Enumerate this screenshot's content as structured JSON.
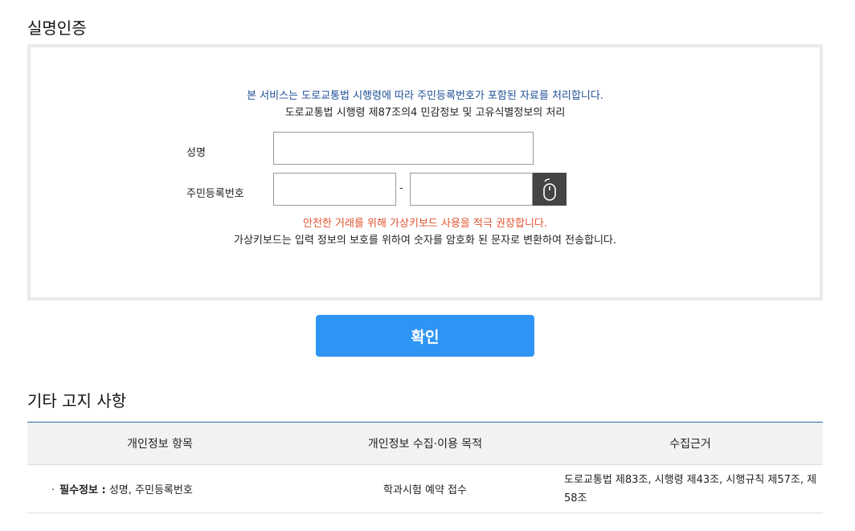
{
  "section1": {
    "title": "실명인증"
  },
  "auth": {
    "notice_blue": "본 서비스는 도로교통법 시행령에 따라 주민등록번호가 포함된 자료를 처리합니다.",
    "notice_black": "도로교통법 시행령 제87조의4 민감정보 및 고유식별정보의 처리",
    "name_label": "성명",
    "name_value": "",
    "rrn_label": "주민등록번호",
    "rrn_front_value": "",
    "rrn_back_value": "",
    "dash": "-",
    "vkb_icon": "mouse-icon",
    "warn_red": "안전한 거래를 위해 가상키보드 사용을 적극 권장합니다.",
    "warn_black": "가상키보드는 입력 정보의 보호를 위하여 숫자를 암호화 된 문자로 변환하여 전송합니다."
  },
  "confirm": {
    "label": "확인"
  },
  "section2": {
    "title": "기타 고지 사항"
  },
  "table": {
    "headers": [
      "개인정보 항목",
      "개인정보 수집·이용 목적",
      "수집근거"
    ],
    "rows": [
      {
        "bullet": "·",
        "item_strong": "필수정보 :",
        "item_rest": " 성명, 주민등록번호",
        "purpose": "학과시험 예약 접수",
        "basis": "도로교통법 제83조, 시행령 제43조, 시행규칙 제57조, 제58조"
      }
    ]
  },
  "colors": {
    "accent": "#2f95f5",
    "notice_blue": "#1f4e96",
    "warn_red": "#e2542f",
    "vkb_bg": "#444444"
  }
}
